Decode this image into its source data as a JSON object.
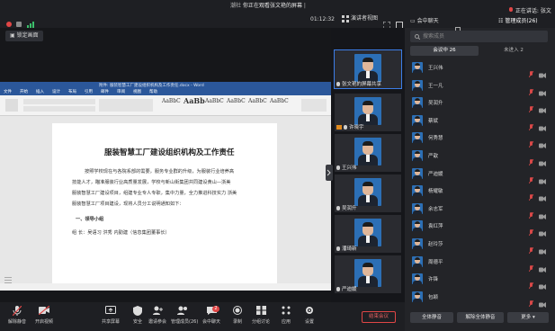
{
  "topbar": {
    "share_notice": "你正在观看张文艳的屏幕",
    "share_prefix": "潮社",
    "share_suffix": "|",
    "timer": "01:12:32",
    "layout_button": "演讲者视图",
    "speaker_status": "正在讲话: 张文"
  },
  "stage": {
    "lock_button": "锁定画面"
  },
  "word": {
    "window_title": "附件: 服装智慧工厂建设组织机构及工作责任.docx - Word",
    "tabs": [
      "文件",
      "开始",
      "插入",
      "设计",
      "布局",
      "引用",
      "邮件",
      "审阅",
      "视图",
      "帮助"
    ],
    "styles": [
      "AaBbC",
      "AaBb",
      "AaBbC",
      "AaBbC",
      "AaBbC",
      "AaBbC"
    ],
    "doc_title": "服装智慧工厂建设组织机构及工作责任",
    "para1": "按照学校现在与各院系部的需要，服务专业群的升级，为服装行业培养高",
    "para2": "技能人才，瞄准服装行业高质量发展，学校与新山街集团共同建设黄山—浙美",
    "para3": "服装智慧工厂建设项目，组建专业专人专职，集中力量，全力推进科技实力  浙美",
    "para4": "服装智慧工厂项目建设，现将人员分工说明通知如下：",
    "section1": "一、领导小组",
    "leader_line": "组   长：吴语习   洪秀   内勤建（信息集团董事长）"
  },
  "participants_tiles": [
    {
      "name": "张文艳的屏幕共享",
      "active": true
    },
    {
      "name": "许晓宇",
      "active": false
    },
    {
      "name": "王兴伟",
      "active": false
    },
    {
      "name": "吴润升",
      "active": false
    },
    {
      "name": "潘琦新",
      "active": false
    },
    {
      "name": "严迪媛",
      "active": false
    }
  ],
  "panel": {
    "chat_tab": "会中聊天",
    "members_tab": "管理成员(26)",
    "search_placeholder": "搜索成员",
    "in_meeting_tab": "会议中 26",
    "not_joined_tab": "未进入 2",
    "members": [
      "王兴伟",
      "王一凡",
      "吴润升",
      "蔡斌",
      "何秀慧",
      "严歆",
      "严迪媛",
      "杨耀敏",
      "余志军",
      "袁红萍",
      "赵玲莎",
      "周德平",
      "许锋",
      "包颖"
    ],
    "mute_all_button": "全体静音",
    "unmute_all_button": "解除全体静音",
    "more_button": "更多"
  },
  "toolbar": {
    "buttons": [
      "解除静音",
      "开启视频",
      "共享屏幕",
      "安全",
      "邀请参会",
      "管理成员(26)",
      "会中聊天",
      "录制",
      "分组讨论",
      "应用",
      "设置"
    ],
    "chat_badge": "2",
    "end_button": "结束会议"
  },
  "colors": {
    "accent": "#3c7ee8",
    "danger": "#e04646",
    "word_blue": "#2b579a"
  }
}
